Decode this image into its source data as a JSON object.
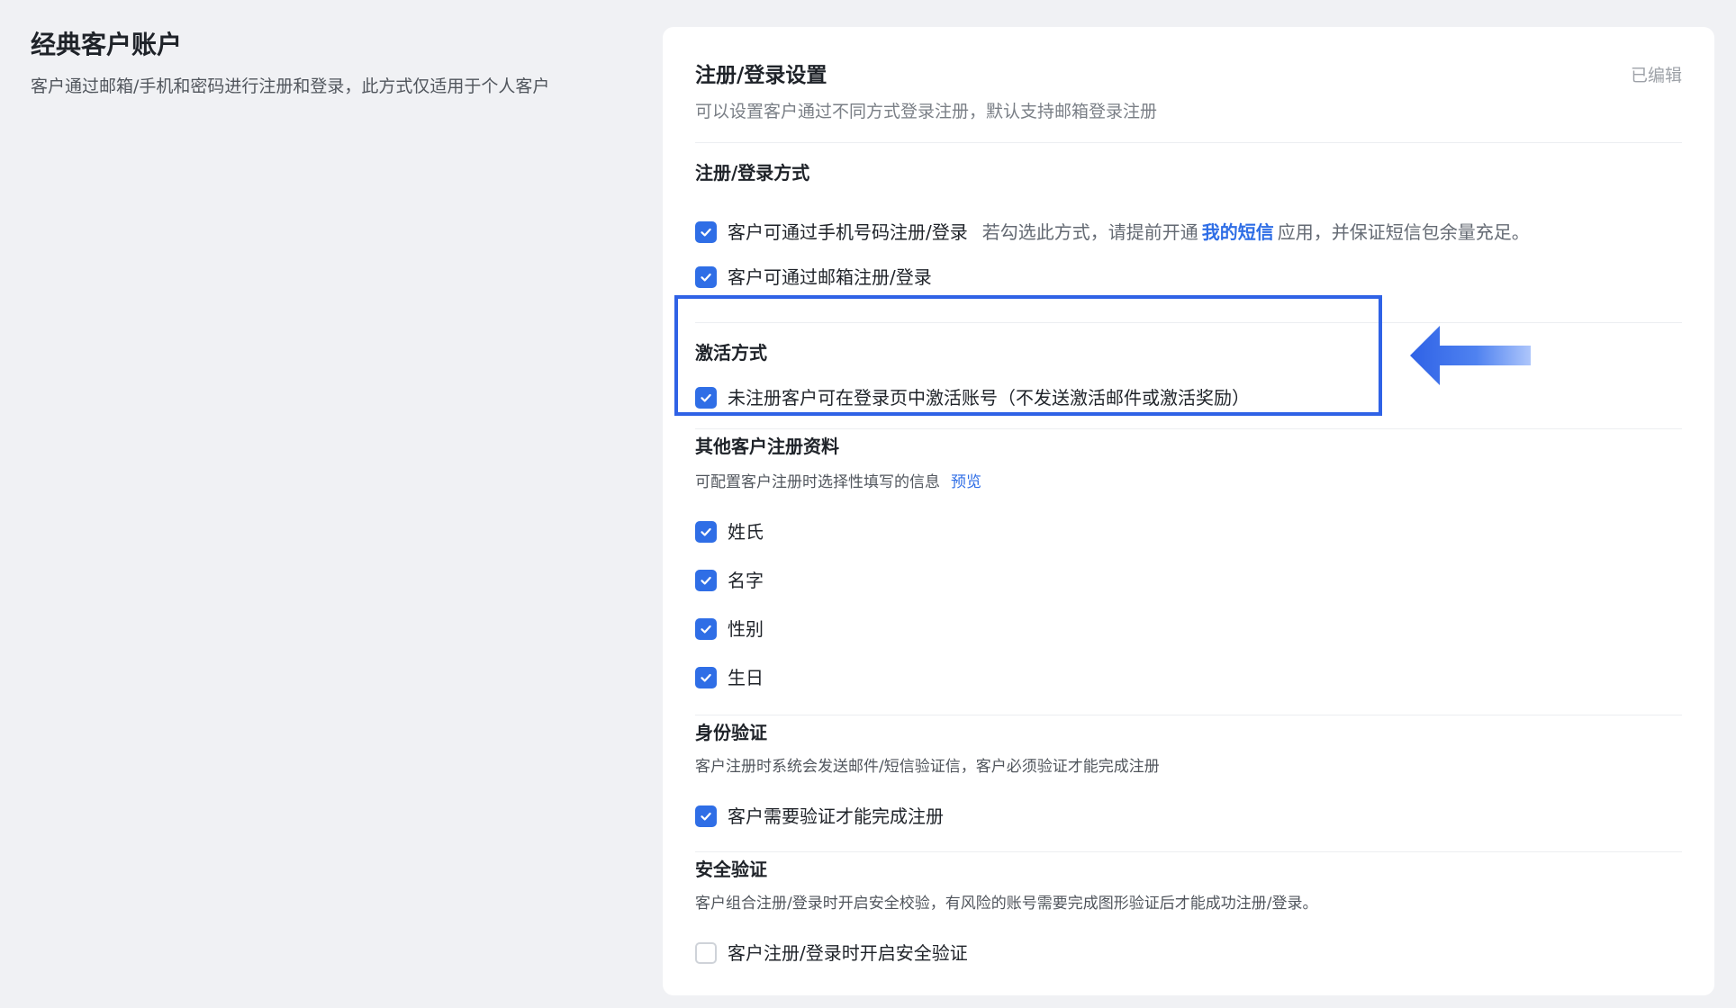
{
  "left": {
    "title": "经典客户账户",
    "description": "客户通过邮箱/手机和密码进行注册和登录，此方式仅适用于个人客户"
  },
  "card": {
    "title": "注册/登录设置",
    "edited_label": "已编辑",
    "description": "可以设置客户通过不同方式登录注册，默认支持邮箱登录注册"
  },
  "login_methods": {
    "title": "注册/登录方式",
    "phone": {
      "label": "客户可通过手机号码注册/登录",
      "checked": true,
      "hint_prefix": "若勾选此方式，请提前开通",
      "hint_link": "我的短信",
      "hint_suffix": "应用，并保证短信包余量充足。"
    },
    "email": {
      "label": "客户可通过邮箱注册/登录",
      "checked": true
    }
  },
  "activation": {
    "title": "激活方式",
    "option": {
      "label": "未注册客户可在登录页中激活账号（不发送激活邮件或激活奖励）",
      "checked": true
    }
  },
  "other_info": {
    "title": "其他客户注册资料",
    "description": "可配置客户注册时选择性填写的信息",
    "preview_link": "预览",
    "fields": [
      {
        "label": "姓氏",
        "checked": true
      },
      {
        "label": "名字",
        "checked": true
      },
      {
        "label": "性别",
        "checked": true
      },
      {
        "label": "生日",
        "checked": true
      }
    ]
  },
  "identity": {
    "title": "身份验证",
    "description": "客户注册时系统会发送邮件/短信验证信，客户必须验证才能完成注册",
    "option": {
      "label": "客户需要验证才能完成注册",
      "checked": true
    }
  },
  "security": {
    "title": "安全验证",
    "description": "客户组合注册/登录时开启安全校验，有风险的账号需要完成图形验证后才能成功注册/登录。",
    "option": {
      "label": "客户注册/登录时开启安全验证",
      "checked": false
    }
  },
  "colors": {
    "accent": "#2f6ee6",
    "highlight": "#2f62e6",
    "background": "#f0f1f4"
  }
}
